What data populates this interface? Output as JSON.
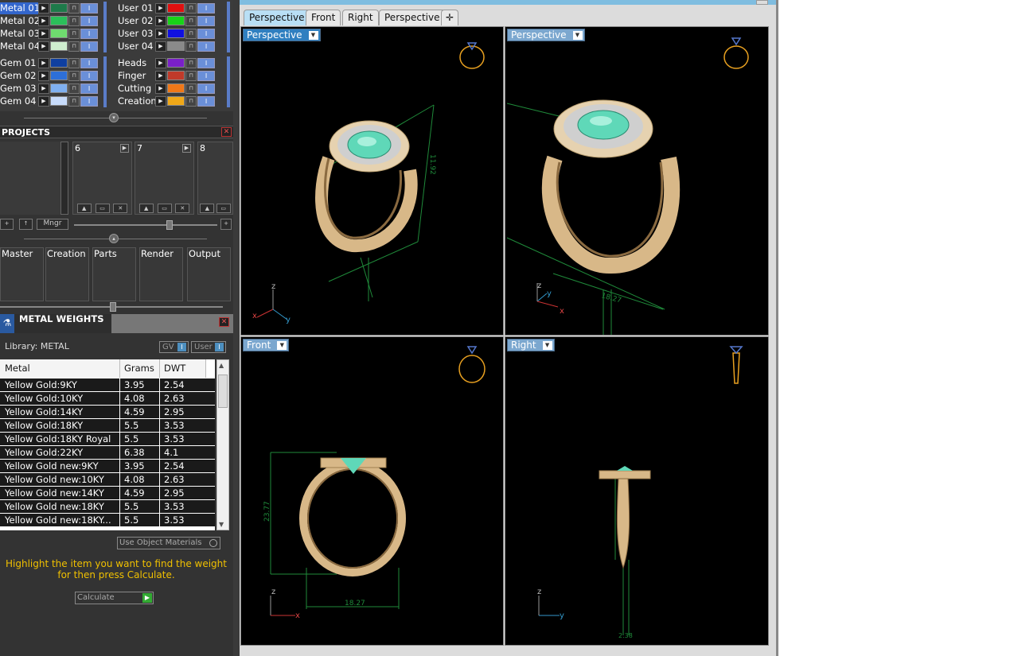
{
  "layers": {
    "metals": [
      "Metal 01",
      "Metal 02",
      "Metal 03",
      "Metal 04"
    ],
    "metal_colors": [
      "#1e7a4a",
      "#2bbf5a",
      "#6fdc6f",
      "#cfeecf"
    ],
    "gems": [
      "Gem 01",
      "Gem 02",
      "Gem 03",
      "Gem 04"
    ],
    "gem_colors": [
      "#0f3fa0",
      "#2d6fd8",
      "#7fb0f0",
      "#c8dcfb"
    ],
    "users": [
      "User 01",
      "User 02",
      "User 03",
      "User 04"
    ],
    "user_colors": [
      "#e01010",
      "#18d418",
      "#1010e0",
      "#8a8a8a"
    ],
    "cats": [
      "Heads",
      "Finger",
      "Cutting",
      "Creation"
    ],
    "cat_colors": [
      "#7a20c8",
      "#c03a2a",
      "#f07818",
      "#f0a818"
    ]
  },
  "projects": {
    "title": "PROJECTS",
    "cards": [
      "6",
      "7",
      "8"
    ],
    "mngr": "Mngr"
  },
  "tools": [
    "Master",
    "Creation",
    "Parts",
    "Render",
    "Output"
  ],
  "metal_weights": {
    "title": "METAL WEIGHTS",
    "library": "Library: METAL",
    "gv": "GV",
    "user": "User",
    "headers": [
      "Metal",
      "Grams",
      "DWT"
    ],
    "rows": [
      [
        "Yellow Gold:9KY",
        "3.95",
        "2.54"
      ],
      [
        "Yellow Gold:10KY",
        "4.08",
        "2.63"
      ],
      [
        "Yellow Gold:14KY",
        "4.59",
        "2.95"
      ],
      [
        "Yellow Gold:18KY",
        "5.5",
        "3.53"
      ],
      [
        "Yellow Gold:18KY Royal",
        "5.5",
        "3.53"
      ],
      [
        "Yellow Gold:22KY",
        "6.38",
        "4.1"
      ],
      [
        "Yellow Gold new:9KY",
        "3.95",
        "2.54"
      ],
      [
        "Yellow Gold new:10KY",
        "4.08",
        "2.63"
      ],
      [
        "Yellow Gold new:14KY",
        "4.59",
        "2.95"
      ],
      [
        "Yellow Gold new:18KY",
        "5.5",
        "3.53"
      ],
      [
        "Yellow Gold new:18KY...",
        "5.5",
        "3.53"
      ]
    ],
    "use_object_materials": "Use Object Materials",
    "hint_line1": "Highlight the item you want to find the weight",
    "hint_line2": "for then press Calculate.",
    "calculate": "Calculate"
  },
  "viewport_tabs": [
    "Perspective",
    "Front",
    "Right",
    "Perspective"
  ],
  "viewports": [
    {
      "label": "Perspective",
      "dim": "11.92",
      "axes": [
        "z",
        "x",
        "y"
      ]
    },
    {
      "label": "Perspective",
      "dim": "18.27",
      "axes": [
        "z",
        "y",
        "x"
      ]
    },
    {
      "label": "Front",
      "dim_h": "23.77",
      "dim_w": "18.27",
      "axes": [
        "z",
        "x"
      ]
    },
    {
      "label": "Right",
      "dim": "2.38",
      "axes": [
        "z",
        "y"
      ]
    }
  ],
  "colors": {
    "gold": "#d8b888",
    "gem": "#5fd8b8",
    "dimension": "#1f8a3a"
  }
}
